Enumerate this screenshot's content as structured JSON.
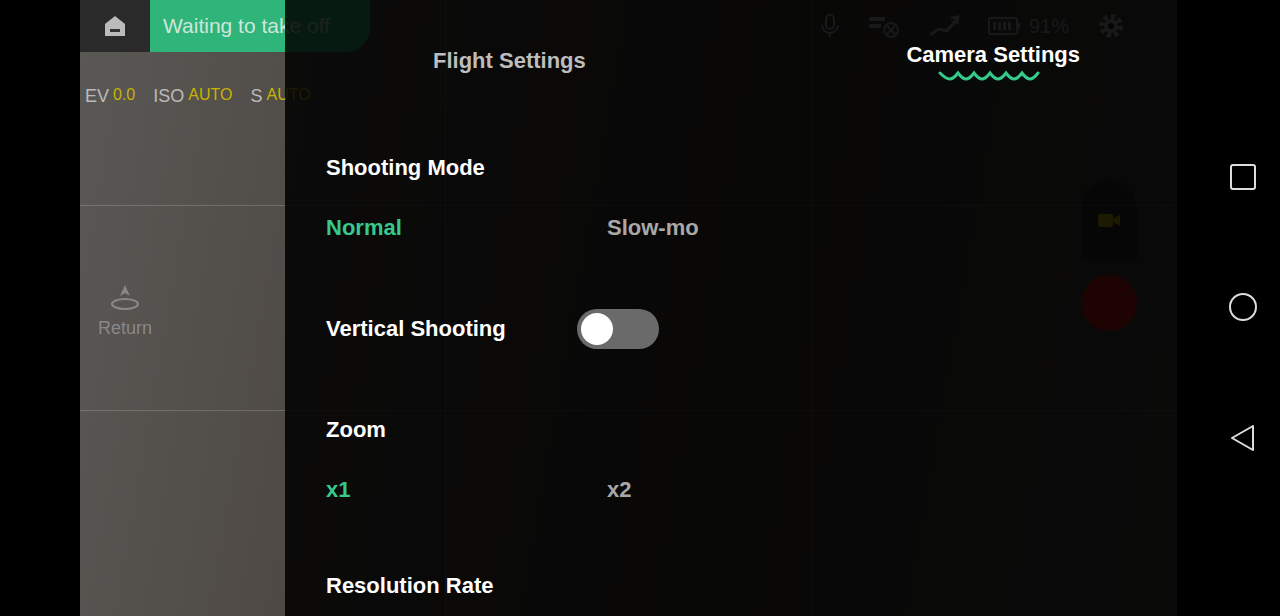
{
  "status": {
    "message": "Waiting to take off",
    "battery": "91%"
  },
  "exposure": [
    {
      "label": "EV",
      "value": "0.0"
    },
    {
      "label": "ISO",
      "value": "AUTO"
    },
    {
      "label": "S",
      "value": "AUTO"
    }
  ],
  "return_button": {
    "label": "Return"
  },
  "tabs": [
    {
      "label": "Flight Settings",
      "selected": false
    },
    {
      "label": "Camera Settings",
      "selected": true
    }
  ],
  "settings": [
    {
      "kind": "options",
      "label": "Shooting Mode",
      "options": [
        {
          "label": "Normal",
          "selected": true
        },
        {
          "label": "Slow-mo",
          "selected": false
        }
      ]
    },
    {
      "kind": "toggle",
      "label": "Vertical Shooting",
      "on": false
    },
    {
      "kind": "options",
      "label": "Zoom",
      "options": [
        {
          "label": "x1",
          "selected": true
        },
        {
          "label": "x2",
          "selected": false
        }
      ]
    },
    {
      "kind": "header",
      "label": "Resolution Rate"
    }
  ]
}
